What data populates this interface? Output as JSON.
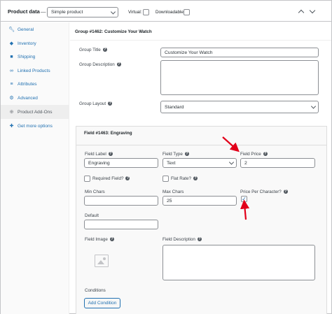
{
  "header": {
    "title": "Product data",
    "dash": "—",
    "product_type": "Simple product",
    "virtual_label": "Virtual:",
    "downloadable_label": "Downloadable:"
  },
  "sidebar": {
    "items": [
      {
        "label": "General",
        "icon": "wrench-icon"
      },
      {
        "label": "Inventory",
        "icon": "tag-icon"
      },
      {
        "label": "Shipping",
        "icon": "truck-icon"
      },
      {
        "label": "Linked Products",
        "icon": "link-icon"
      },
      {
        "label": "Attributes",
        "icon": "list-icon"
      },
      {
        "label": "Advanced",
        "icon": "gear-icon"
      },
      {
        "label": "Product Add-Ons",
        "icon": "plus-circle-icon"
      },
      {
        "label": "Get more options",
        "icon": "puzzle-icon"
      }
    ]
  },
  "group": {
    "header": "Group #1462: Customize Your Watch",
    "title_label": "Group Title",
    "title_value": "Customize Your Watch",
    "description_label": "Group Description",
    "layout_label": "Group Layout",
    "layout_value": "Standard"
  },
  "field": {
    "header": "Field #1463: Engraving",
    "label_label": "Field Label",
    "label_value": "Engraving",
    "type_label": "Field Type",
    "type_value": "Text",
    "price_label": "Field Price",
    "price_value": "2",
    "required_label": "Required Field?",
    "flat_rate_label": "Flat Rate?",
    "min_chars_label": "Min Chars",
    "max_chars_label": "Max Chars",
    "max_chars_value": "25",
    "price_per_char_label": "Price Per Character?",
    "price_per_char_checked": true,
    "default_label": "Default",
    "image_label": "Field Image",
    "description_label": "Field Description",
    "conditions_label": "Conditions",
    "add_condition_label": "Add Condition"
  },
  "colors": {
    "link": "#2271b1",
    "annotation_arrow": "#e2001a"
  }
}
